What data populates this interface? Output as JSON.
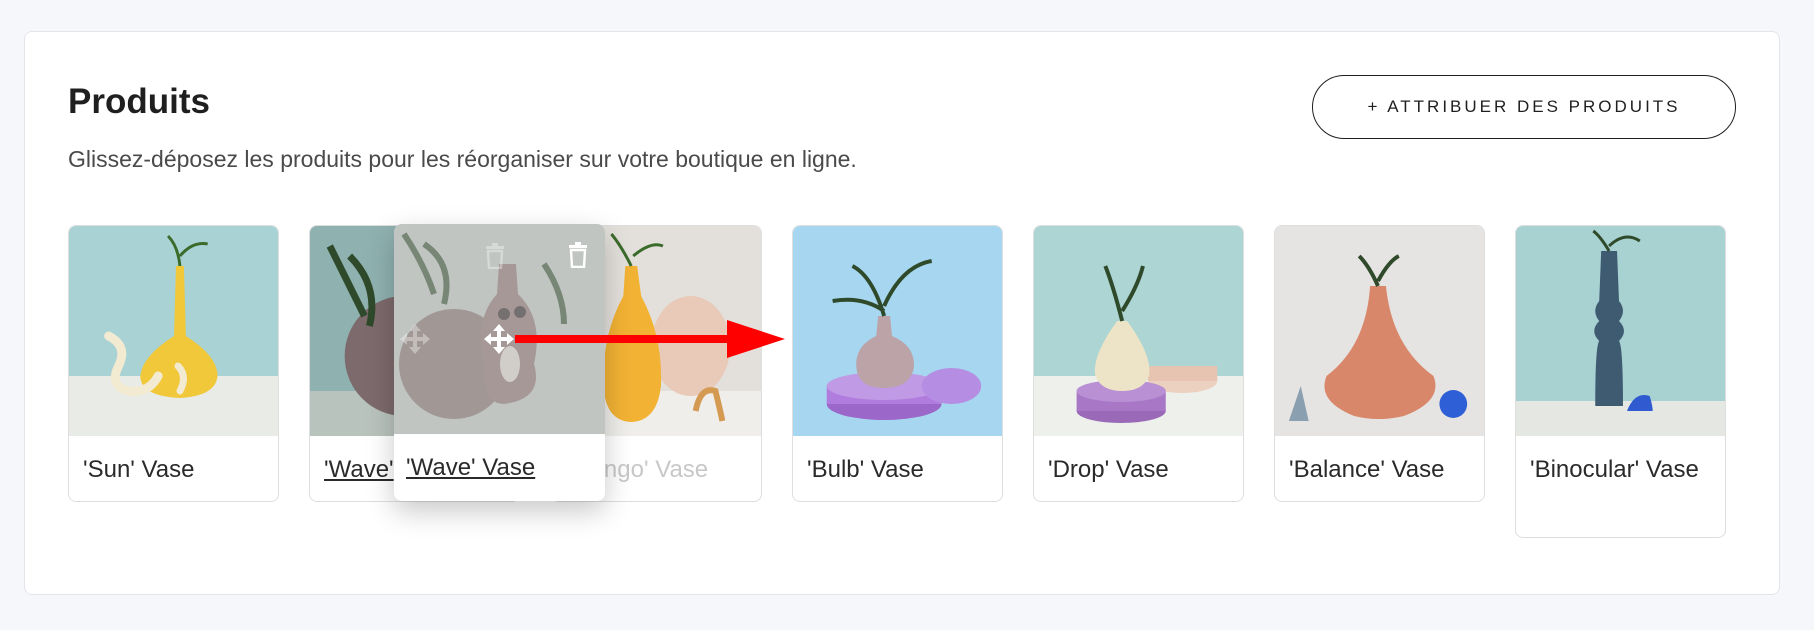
{
  "section": {
    "title": "Produits",
    "subtitle": "Glissez-déposez les produits pour les réorganiser sur votre boutique en ligne.",
    "assign_button": "+ ATTRIBUER DES PRODUITS"
  },
  "products": [
    {
      "name": "'Sun' Vase"
    },
    {
      "name": "'Wave' Vase"
    },
    {
      "name": "'Mango' Vase"
    },
    {
      "name": "'Bulb' Vase"
    },
    {
      "name": "'Drop' Vase"
    },
    {
      "name": "'Balance' Vase"
    },
    {
      "name": "'Binocular' Vase"
    }
  ],
  "drag": {
    "label": "'Wave' Vase",
    "ghost_label_visible": "'Wave'",
    "mango_partial": "'Mango' Vase",
    "arrow_color": "#ff0000"
  },
  "icons": {
    "delete": "trash-icon",
    "move": "move-icon",
    "drag_direction": "arrow-right-icon"
  }
}
